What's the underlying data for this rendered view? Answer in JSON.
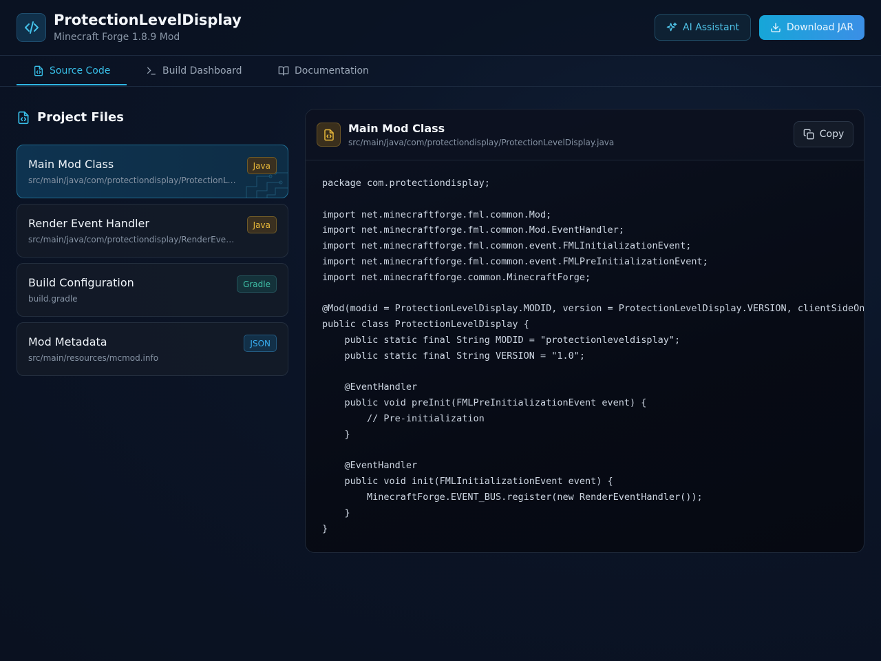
{
  "header": {
    "title": "ProtectionLevelDisplay",
    "subtitle": "Minecraft Forge 1.8.9 Mod",
    "logo_icon": "code-brackets-icon",
    "ai_label": "AI Assistant",
    "download_label": "Download JAR"
  },
  "tabs": [
    {
      "label": "Source Code",
      "icon": "file-code-icon",
      "active": true
    },
    {
      "label": "Build Dashboard",
      "icon": "terminal-icon",
      "active": false
    },
    {
      "label": "Documentation",
      "icon": "book-open-icon",
      "active": false
    }
  ],
  "sidebar": {
    "title": "Project Files",
    "files": [
      {
        "name": "Main Mod Class",
        "path": "src/main/java/com/protectiondisplay/ProtectionLevelDisplay.java",
        "badge": "Java",
        "active": true
      },
      {
        "name": "Render Event Handler",
        "path": "src/main/java/com/protectiondisplay/RenderEventHandler.java",
        "badge": "Java",
        "active": false
      },
      {
        "name": "Build Configuration",
        "path": "build.gradle",
        "badge": "Gradle",
        "active": false
      },
      {
        "name": "Mod Metadata",
        "path": "src/main/resources/mcmod.info",
        "badge": "JSON",
        "active": false
      }
    ]
  },
  "panel": {
    "title": "Main Mod Class",
    "path": "src/main/java/com/protectiondisplay/ProtectionLevelDisplay.java",
    "copy_label": "Copy",
    "code": "package com.protectiondisplay;\n\nimport net.minecraftforge.fml.common.Mod;\nimport net.minecraftforge.fml.common.Mod.EventHandler;\nimport net.minecraftforge.fml.common.event.FMLInitializationEvent;\nimport net.minecraftforge.fml.common.event.FMLPreInitializationEvent;\nimport net.minecraftforge.common.MinecraftForge;\n\n@Mod(modid = ProtectionLevelDisplay.MODID, version = ProtectionLevelDisplay.VERSION, clientSideOnly = true)\npublic class ProtectionLevelDisplay {\n    public static final String MODID = \"protectionleveldisplay\";\n    public static final String VERSION = \"1.0\";\n\n    @EventHandler\n    public void preInit(FMLPreInitializationEvent event) {\n        // Pre-initialization\n    }\n\n    @EventHandler\n    public void init(FMLInitializationEvent event) {\n        MinecraftForge.EVENT_BUS.register(new RenderEventHandler());\n    }\n}"
  },
  "colors": {
    "accent": "#38bfe8",
    "java_badge": "#e7b83a",
    "gradle_badge": "#3fc1a8",
    "json_badge": "#38aef0"
  }
}
